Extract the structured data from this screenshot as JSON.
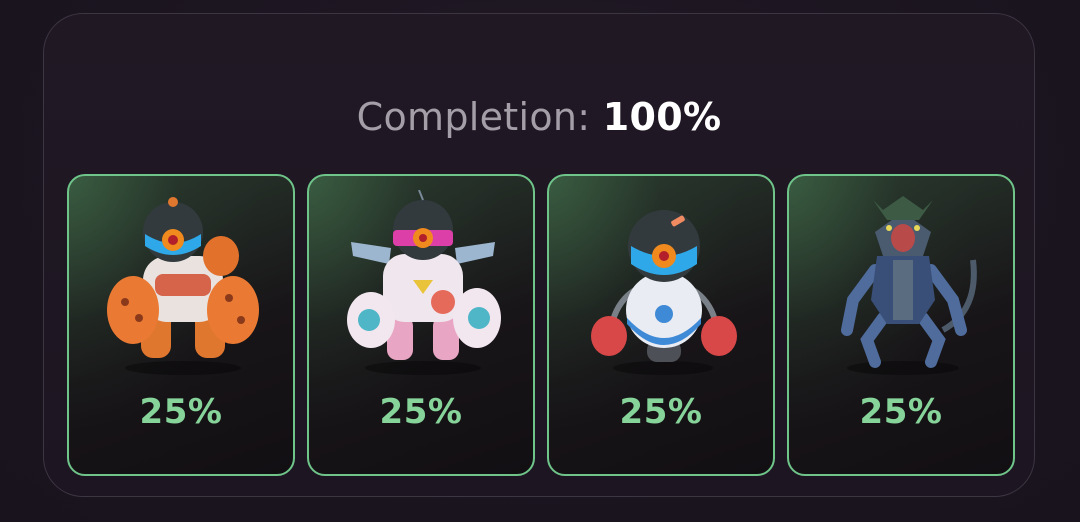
{
  "completion": {
    "label": "Completion:",
    "value": "100%"
  },
  "cards": [
    {
      "icon": "orange-mech-robot-icon",
      "percent": "25%"
    },
    {
      "icon": "white-pink-mech-robot-icon",
      "percent": "25%"
    },
    {
      "icon": "boxing-capsule-robot-icon",
      "percent": "25%"
    },
    {
      "icon": "blue-armored-werewolf-icon",
      "percent": "25%"
    }
  ],
  "colors": {
    "accent_green": "#86d49a",
    "card_border": "#6fc48a",
    "background": "#1c1620"
  }
}
